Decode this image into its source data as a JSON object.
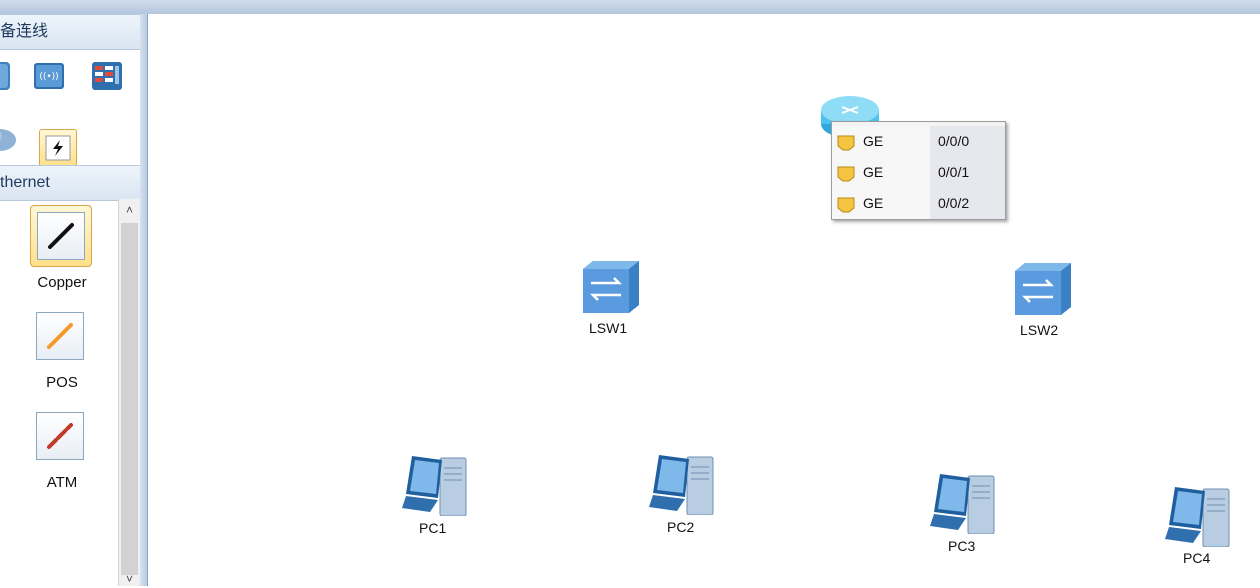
{
  "sidebar": {
    "device_section_title": "备连线",
    "cable_section_title": "thernet",
    "cables": [
      {
        "label": "Copper",
        "selected": true
      },
      {
        "label": "POS",
        "selected": false
      },
      {
        "label": "ATM",
        "selected": false
      }
    ],
    "scroll_up": "˄",
    "scroll_down": "˅"
  },
  "devices": [
    {
      "name": "LSW1",
      "type": "switch-icon"
    },
    {
      "name": "LSW2",
      "type": "switch-icon"
    },
    {
      "name": "PC1",
      "type": "pc-icon"
    },
    {
      "name": "PC2",
      "type": "pc-icon"
    },
    {
      "name": "PC3",
      "type": "pc-icon"
    },
    {
      "name": "PC4",
      "type": "pc-icon"
    }
  ],
  "port_menu": {
    "ports": [
      {
        "type": "GE",
        "number": "0/0/0"
      },
      {
        "type": "GE",
        "number": "0/0/1"
      },
      {
        "type": "GE",
        "number": "0/0/2"
      }
    ]
  },
  "colors": {
    "accent": "#4a90d9",
    "selection": "#ffe08a",
    "port_icon": "#f5c542"
  }
}
